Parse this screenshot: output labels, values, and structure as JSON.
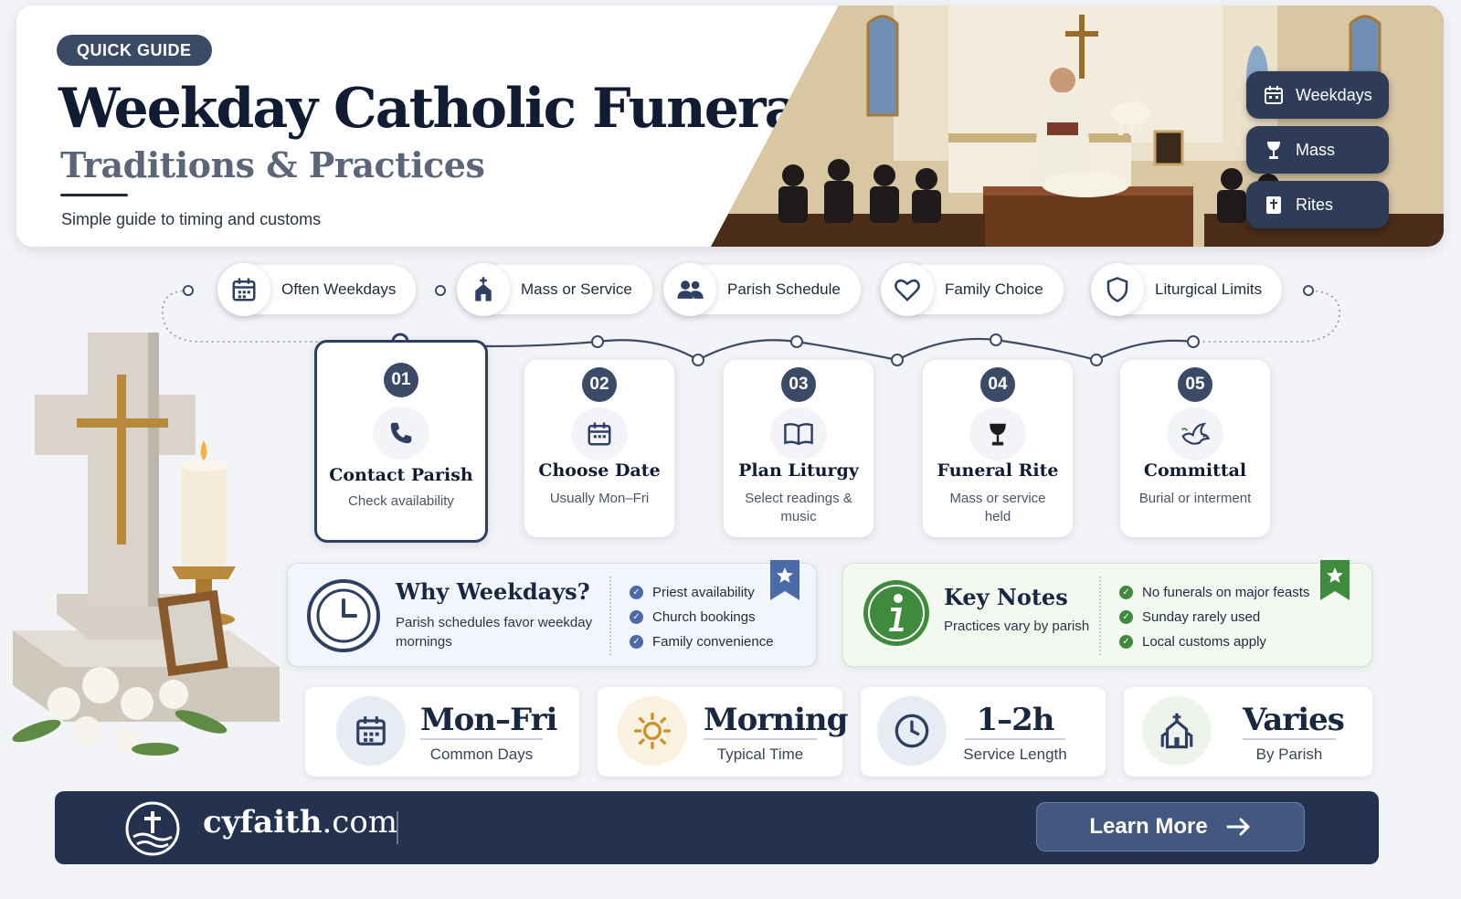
{
  "header": {
    "badge": "QUICK GUIDE",
    "title": "Weekday Catholic Funerals?",
    "subtitle": "Traditions & Practices",
    "tagline": "Simple guide to timing and customs",
    "side_buttons": [
      {
        "label": "Weekdays",
        "icon": "calendar-icon"
      },
      {
        "label": "Mass",
        "icon": "chalice-icon"
      },
      {
        "label": "Rites",
        "icon": "cross-book-icon"
      }
    ]
  },
  "pills": [
    {
      "label": "Often Weekdays",
      "icon": "calendar-icon"
    },
    {
      "label": "Mass or Service",
      "icon": "church-icon"
    },
    {
      "label": "Parish Schedule",
      "icon": "people-icon"
    },
    {
      "label": "Family Choice",
      "icon": "heart-icon"
    },
    {
      "label": "Liturgical Limits",
      "icon": "shield-icon"
    }
  ],
  "steps": [
    {
      "num": "01",
      "title": "Contact Parish",
      "sub": "Check availability",
      "icon": "phone-icon"
    },
    {
      "num": "02",
      "title": "Choose Date",
      "sub": "Usually Mon–Fri",
      "icon": "calendar-icon"
    },
    {
      "num": "03",
      "title": "Plan Liturgy",
      "sub": "Select readings & music",
      "icon": "book-icon"
    },
    {
      "num": "04",
      "title": "Funeral Rite",
      "sub": "Mass or service held",
      "icon": "chalice-icon"
    },
    {
      "num": "05",
      "title": "Committal",
      "sub": "Burial or interment",
      "icon": "dove-icon"
    }
  ],
  "why": {
    "title": "Why Weekdays?",
    "text": "Parish schedules favor weekday mornings",
    "points": [
      "Priest availability",
      "Church bookings",
      "Family convenience"
    ]
  },
  "notes": {
    "title": "Key Notes",
    "text": "Practices vary by parish",
    "points": [
      "No funerals on major feasts",
      "Sunday rarely used",
      "Local customs apply"
    ]
  },
  "stats": [
    {
      "value": "Mon–Fri",
      "label": "Common Days",
      "icon": "calendar-icon"
    },
    {
      "value": "Morning",
      "label": "Typical Time",
      "icon": "sun-icon"
    },
    {
      "value": "1–2h",
      "label": "Service Length",
      "icon": "clock-icon"
    },
    {
      "value": "Varies",
      "label": "By Parish",
      "icon": "church-icon"
    }
  ],
  "footer": {
    "brand_bold": "cyfaith",
    "brand_rest": ".com",
    "cta": "Learn More"
  },
  "colors": {
    "navy": "#243250",
    "slate": "#3b4a66",
    "green": "#3f8a3c",
    "blue_accent": "#4a6aa8"
  }
}
